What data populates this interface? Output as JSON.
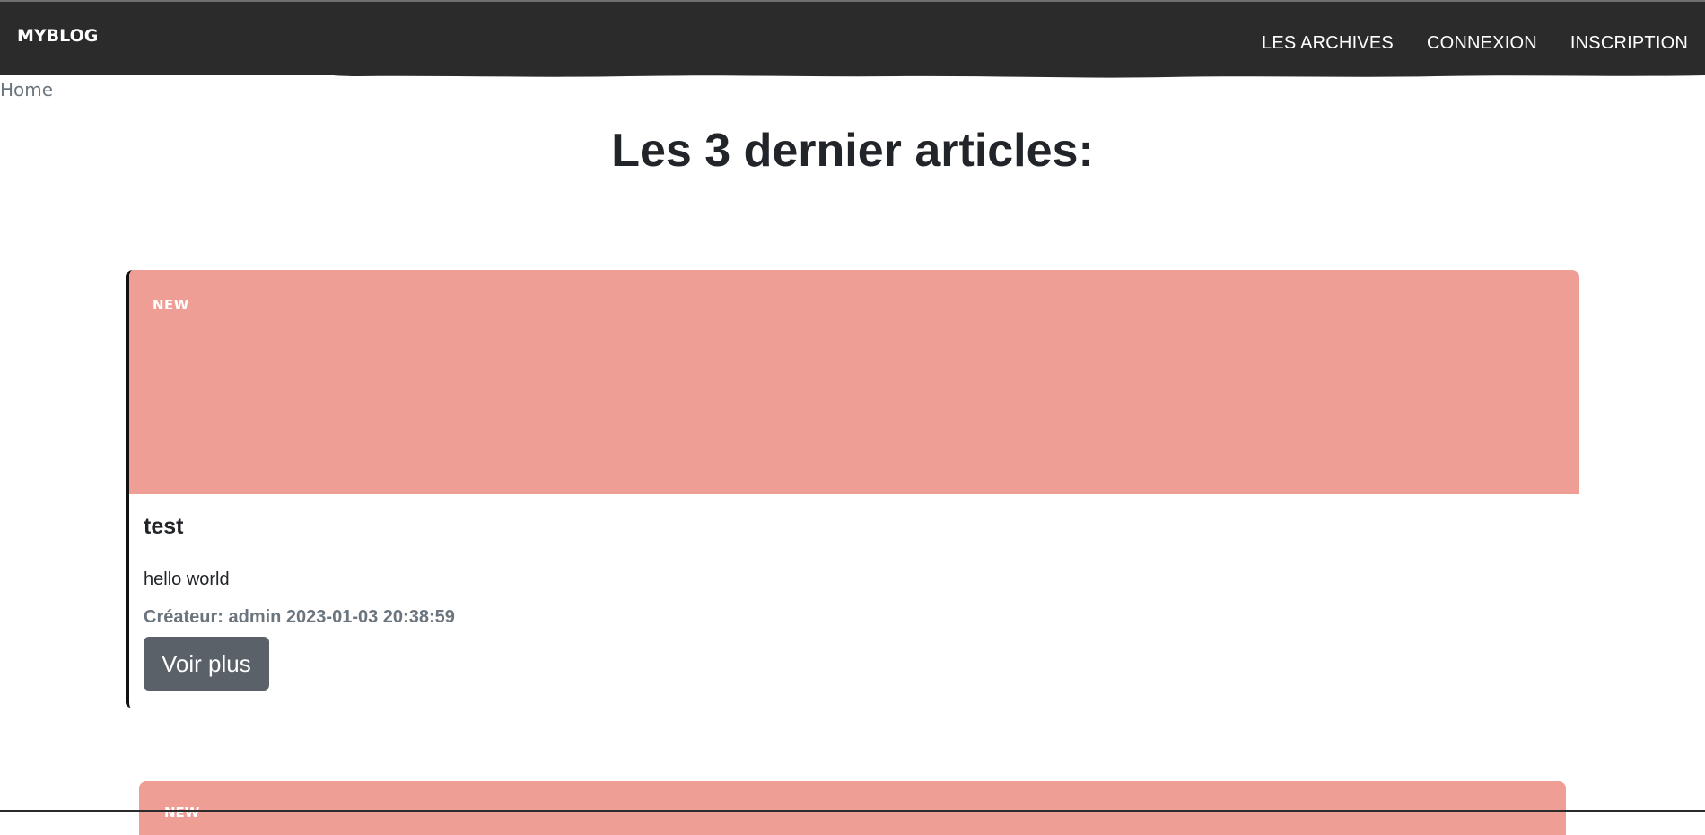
{
  "navbar": {
    "brand": "MYBLOG",
    "links": [
      {
        "label": "LES ARCHIVES"
      },
      {
        "label": "CONNEXION"
      },
      {
        "label": "INSCRIPTION"
      }
    ]
  },
  "breadcrumb": {
    "label": "Home"
  },
  "main": {
    "title": "Les 3 dernier articles:",
    "articles": [
      {
        "badge": "NEW",
        "title": "test",
        "body": "hello world",
        "meta": "Créateur: admin 2023-01-03 20:38:59",
        "button_label": "Voir plus",
        "header_color": "#ee9e95"
      },
      {
        "badge": "NEW",
        "header_color": "#ee9e95"
      }
    ]
  },
  "colors": {
    "navbar_bg": "#2b2b2b",
    "card_header": "#ee9e95",
    "button_bg": "#5a6168",
    "card_border": "#111111"
  }
}
